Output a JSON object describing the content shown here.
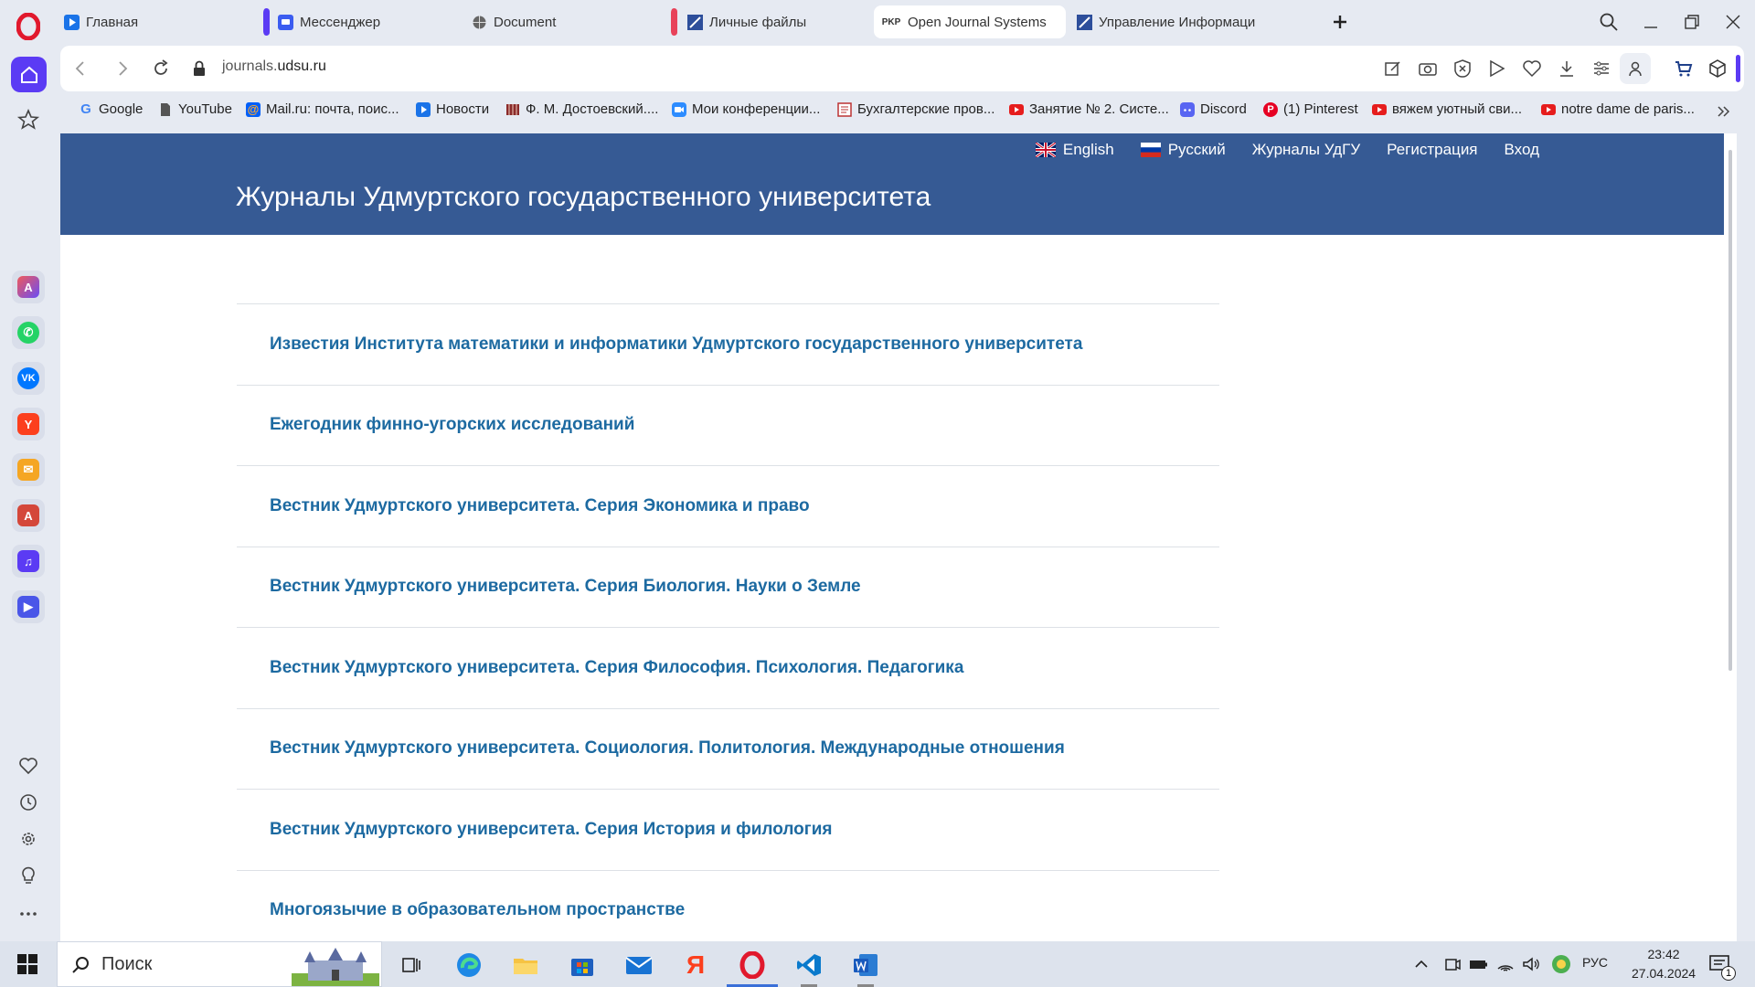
{
  "tabs": [
    {
      "label": "Главная",
      "favicon": "play-icon",
      "color": "#1a73e8"
    },
    {
      "label": "Мессенджер",
      "favicon": "messenger-icon",
      "color": "#3b5cf0"
    },
    {
      "label": "Document",
      "favicon": "globe-icon",
      "color": "#555555"
    },
    {
      "label": "Личные файлы",
      "favicon": "journal-icon",
      "color": "#2d4e9b"
    },
    {
      "label": "Open Journal Systems",
      "favicon": "pkp-icon",
      "color": "#222222"
    },
    {
      "label": "Управление Информаци",
      "favicon": "journal-icon",
      "color": "#2d4e9b"
    }
  ],
  "address": {
    "host_prefix": "journals.",
    "host_main": "udsu.ru"
  },
  "bookmarks": [
    {
      "label": "Google",
      "icon": "google-icon"
    },
    {
      "label": "YouTube",
      "icon": "page-icon"
    },
    {
      "label": "Mail.ru: почта, поис...",
      "icon": "mailru-icon"
    },
    {
      "label": "Новости",
      "icon": "play-icon"
    },
    {
      "label": "Ф. М. Достоевский....",
      "icon": "book-icon"
    },
    {
      "label": "Мои конференции...",
      "icon": "zoom-icon"
    },
    {
      "label": "Бухгалтерские пров...",
      "icon": "doc-icon"
    },
    {
      "label": "Занятие № 2. Систе...",
      "icon": "youtube-icon"
    },
    {
      "label": "Discord",
      "icon": "discord-icon"
    },
    {
      "label": "(1) Pinterest",
      "icon": "pinterest-icon"
    },
    {
      "label": "вяжем уютный сви...",
      "icon": "youtube-icon"
    },
    {
      "label": "notre dame de paris...",
      "icon": "youtube-icon"
    }
  ],
  "site": {
    "title": "Журналы Удмуртского государственного университета",
    "nav": {
      "english": "English",
      "russian": "Русский",
      "journals": "Журналы УдГУ",
      "register": "Регистрация",
      "login": "Вход"
    },
    "journals": [
      "Известия Института математики и информатики Удмуртского государственного университета",
      "Ежегодник финно-угорских исследований",
      "Вестник Удмуртского университета. Серия Экономика и право",
      "Вестник Удмуртского университета. Серия Биология. Науки о Земле",
      "Вестник Удмуртского университета. Серия Философия. Психология. Педагогика",
      "Вестник Удмуртского университета. Социология. Политология. Международные отношения",
      "Вестник Удмуртского университета. Серия История и филология",
      "Многоязычие в образовательном пространстве"
    ]
  },
  "taskbar": {
    "search_label": "Поиск",
    "lang": "РУС",
    "time": "23:42",
    "date": "27.04.2024",
    "notifications": "1"
  },
  "colors": {
    "header": "#365a94",
    "link": "#1d6aa1",
    "opera_accent": "#5b3bf4"
  }
}
